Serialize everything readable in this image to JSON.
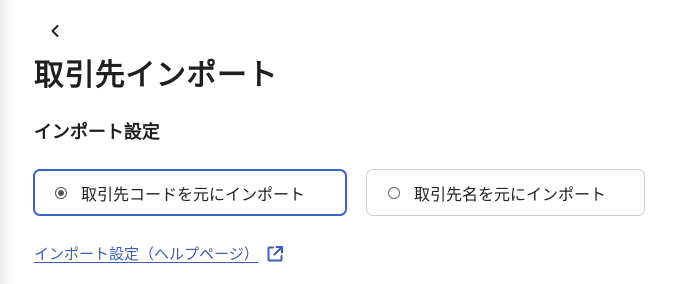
{
  "header": {
    "back_icon": "chevron-left-icon",
    "title": "取引先インポート"
  },
  "settings": {
    "section_title": "インポート設定",
    "options": [
      {
        "label": "取引先コードを元にインポート",
        "selected": true
      },
      {
        "label": "取引先名を元にインポート",
        "selected": false
      }
    ],
    "help_link": {
      "label": "インポート設定（ヘルプページ）",
      "icon": "external-link-icon"
    }
  },
  "colors": {
    "accent": "#3a64c8",
    "link": "#3a5db5",
    "border": "#d0d0d0",
    "text": "#1f1f1f"
  }
}
